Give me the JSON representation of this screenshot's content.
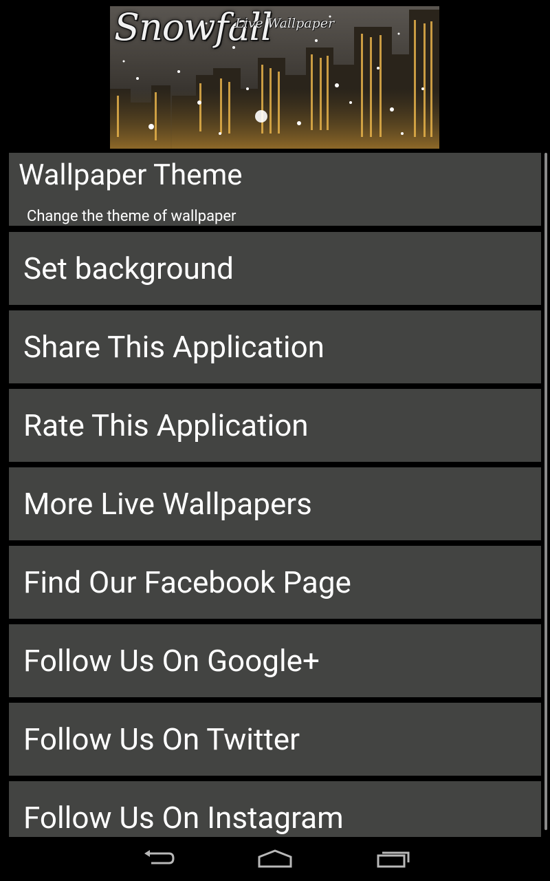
{
  "banner": {
    "title": "Snowfall",
    "subtitle": "Live Wallpaper"
  },
  "menu": {
    "items": [
      {
        "label": "Wallpaper Theme",
        "summary": "Change the theme of wallpaper"
      },
      {
        "label": "Set background"
      },
      {
        "label": "Share This Application"
      },
      {
        "label": "Rate This Application"
      },
      {
        "label": "More Live Wallpapers"
      },
      {
        "label": "Find Our Facebook Page"
      },
      {
        "label": "Follow Us On Google+"
      },
      {
        "label": "Follow Us On Twitter"
      },
      {
        "label": "Follow Us On Instagram"
      }
    ]
  },
  "navbar": {
    "icons": [
      "back-icon",
      "home-icon",
      "recent-apps-icon"
    ]
  },
  "colors": {
    "background": "#000000",
    "item_background": "#434442",
    "text": "#ffffff"
  }
}
